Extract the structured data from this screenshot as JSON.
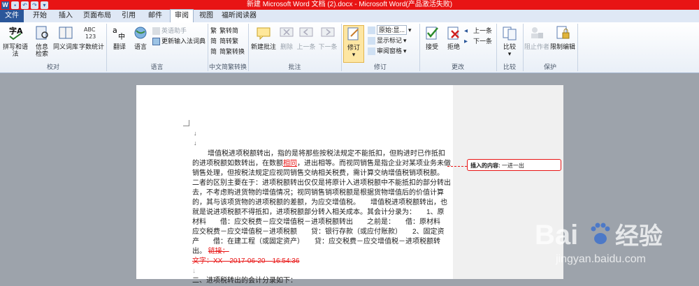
{
  "window": {
    "title": "新建 Microsoft Word 文档 (2).docx  -  Microsoft Word(产品激活失败)"
  },
  "tabs": [
    "文件",
    "开始",
    "插入",
    "页面布局",
    "引用",
    "邮件",
    "审阅",
    "视图",
    "福昕阅读器"
  ],
  "active_tab": "审阅",
  "ribbon": {
    "proofing": {
      "label": "校对",
      "spelling": "拼写和语法",
      "research": "信息检索",
      "thesaurus": "同义词库",
      "wordcount": "字数统计"
    },
    "language": {
      "label": "语言",
      "translate": "翻译",
      "language": "语言",
      "english_assistant": "英语助手",
      "update_ime": "更新输入法词典"
    },
    "chinese": {
      "label": "中文简繁转换",
      "to_simplified": "繁转简",
      "to_traditional": "简转繁",
      "convert": "简繁转换"
    },
    "comments": {
      "label": "批注",
      "new": "新建批注",
      "delete": "删除",
      "prev": "上一条",
      "next": "下一条"
    },
    "tracking": {
      "label": "修订",
      "track": "修订",
      "display_value": "原始:显...",
      "show_markup": "显示标记",
      "review_pane": "审阅窗格"
    },
    "changes": {
      "label": "更改",
      "accept": "接受",
      "reject": "拒绝",
      "prev": "上一条",
      "next": "下一条"
    },
    "compare": {
      "label": "比较",
      "compare": "比较"
    },
    "protect": {
      "label": "保护",
      "block_authors": "阻止作者",
      "restrict": "限制编辑"
    }
  },
  "document": {
    "para_text_1": "增值税进项税额转出，指的是将那些按税法规定不能抵扣，但购进时已作抵扣的进项税额如数转出，在数额",
    "inserted_word": "相同",
    "para_text_2": "，进出相等。而视同销售是指企业对某项业务未做销售处理，但按税法规定应视同销售交纳相关税费，需计算交纳增值税销项税额。　　二者的区别主要在于：进项税额转出仅仅是将原计入进项税额中不能抵扣的部分转出去，不考虑购进货物的增值情况；视同销售销项税额是根据货物增值后的价值计算的，其与该项货物的进项税额的差额，为应交增值税。　　增值税进项税额转出，也就是说进项税额不得抵扣，进项税额部分转入相关成本。其会计分录为：　　1、原材料　　借：应交税费－应交增值税－进项税额转出　　之前是：　　借：原材料　　应交税费－应交增值税－进项税额　　贷：银行存款（或应付账款）　　2、固定资产　　借：在建工程（或固定资产）　　贷：应交税费－应交增值税－进项税额转出。",
    "deleted_link": "链接：",
    "deleted_line": "文字：XX　2017-06-20　16:54:36",
    "last_line": "二、进项税转出的会计分录如下："
  },
  "balloon": {
    "label": "插入的内容:",
    "text": "一进一出"
  },
  "watermark": {
    "brand": "Bai",
    "brand_after": "经验",
    "url": "jingyan.baidu.com"
  }
}
